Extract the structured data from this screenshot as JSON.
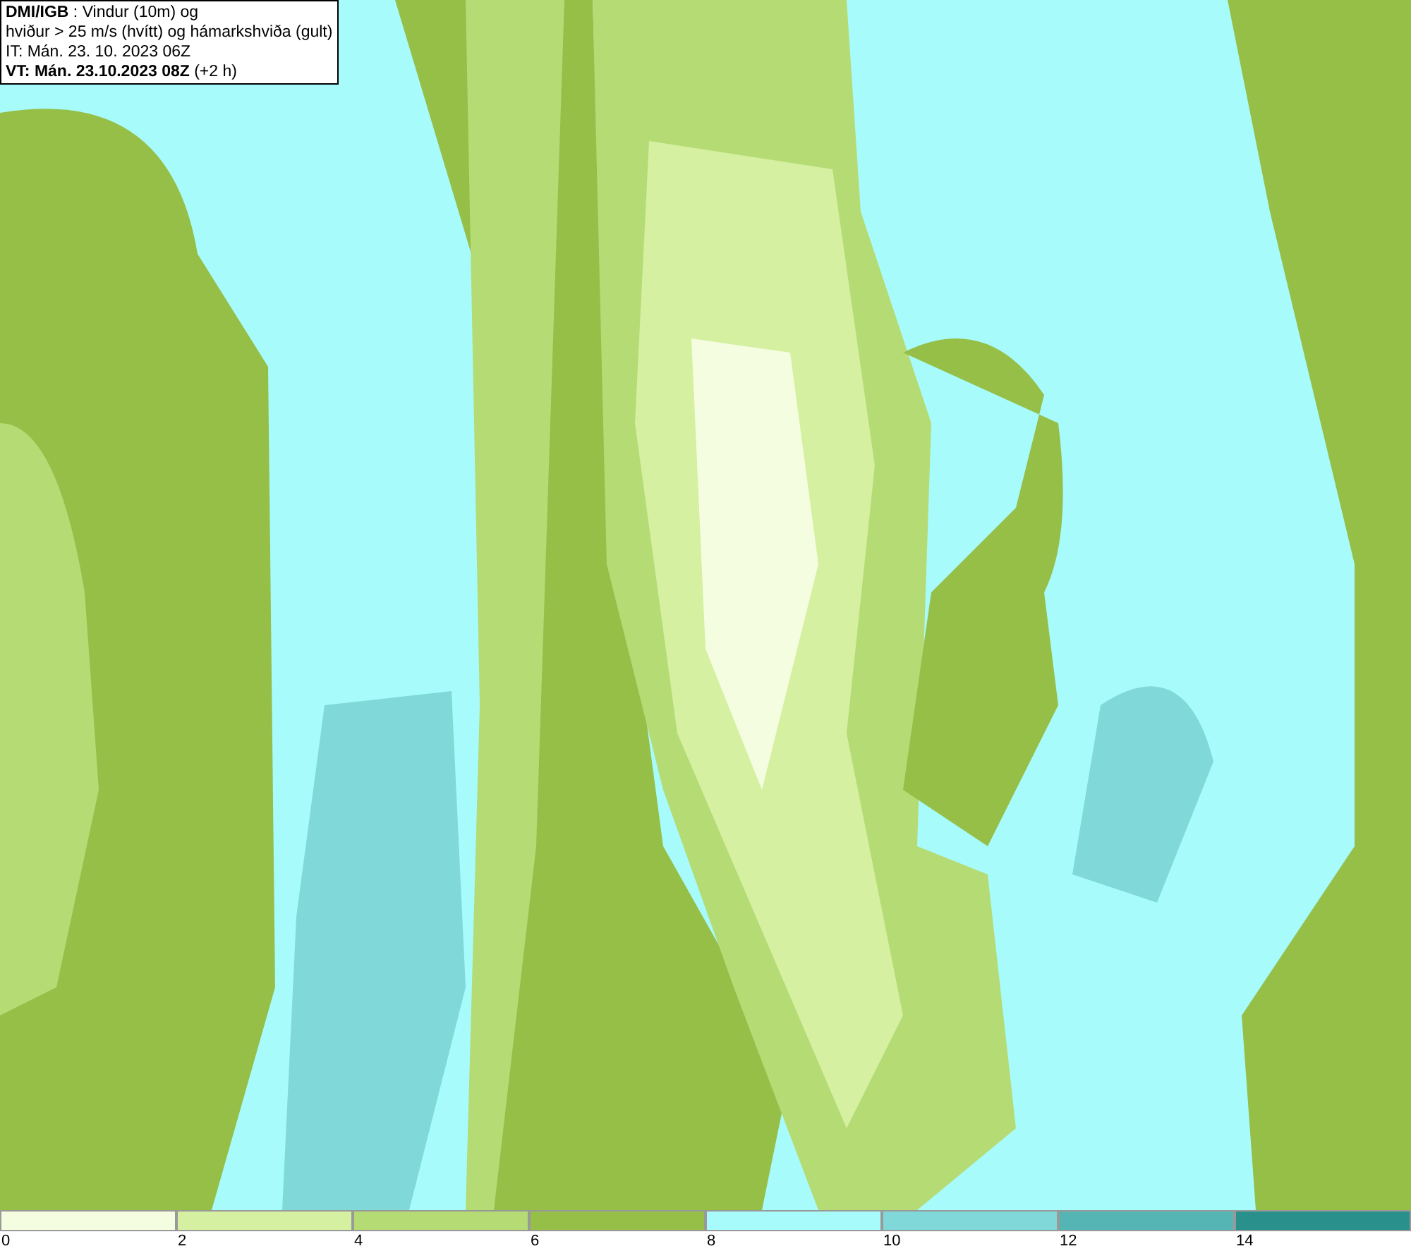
{
  "header": {
    "lines": [
      "**DMI/IGB** : Vindur (10m) og",
      "hviður > 25 m/s (hvítt) og hámarkshviða (gult)",
      "IT: Mán. 23. 10. 2023 06Z",
      "**VT: Mán. 23.10.2023 08Z** (+2 h)"
    ]
  },
  "legend": {
    "segments": [
      {
        "color": "#f5fde0"
      },
      {
        "color": "#d4f0a0"
      },
      {
        "color": "#b5db75"
      },
      {
        "color": "#96bf48"
      },
      {
        "color": "#a8fbfb"
      },
      {
        "color": "#80d8d8"
      },
      {
        "color": "#55b5b5"
      },
      {
        "color": "#2a908c"
      }
    ],
    "ticks": [
      "0",
      "2",
      "4",
      "6",
      "8",
      "10",
      "12",
      "14"
    ]
  }
}
